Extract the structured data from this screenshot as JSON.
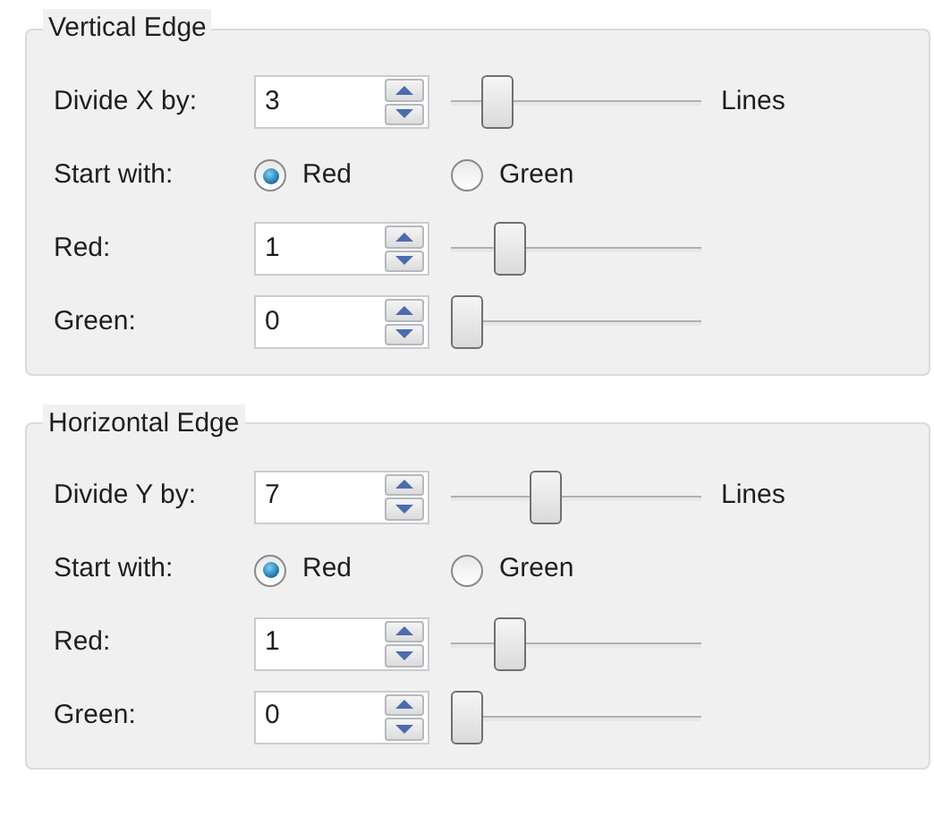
{
  "sections": [
    {
      "title": "Vertical Edge",
      "rows": [
        {
          "kind": "spin",
          "label": "Divide X by:",
          "value": "3",
          "level": 0.14,
          "unit": "Lines"
        },
        {
          "kind": "radio",
          "label": "Start with:",
          "options": [
            {
              "label": "Red",
              "selected": true
            },
            {
              "label": "Green",
              "selected": false
            }
          ]
        },
        {
          "kind": "spin",
          "label": "Red:",
          "value": "1",
          "level": 0.2
        },
        {
          "kind": "spin",
          "label": "Green:",
          "value": "0",
          "level": 0
        }
      ]
    },
    {
      "title": "Horizontal Edge",
      "rows": [
        {
          "kind": "spin",
          "label": "Divide Y by:",
          "value": "7",
          "level": 0.36,
          "unit": "Lines"
        },
        {
          "kind": "radio",
          "label": "Start with:",
          "options": [
            {
              "label": "Red",
              "selected": true
            },
            {
              "label": "Green",
              "selected": false
            }
          ]
        },
        {
          "kind": "spin",
          "label": "Red:",
          "value": "1",
          "level": 0.2
        },
        {
          "kind": "spin",
          "label": "Green:",
          "value": "0",
          "level": 0
        }
      ]
    }
  ]
}
